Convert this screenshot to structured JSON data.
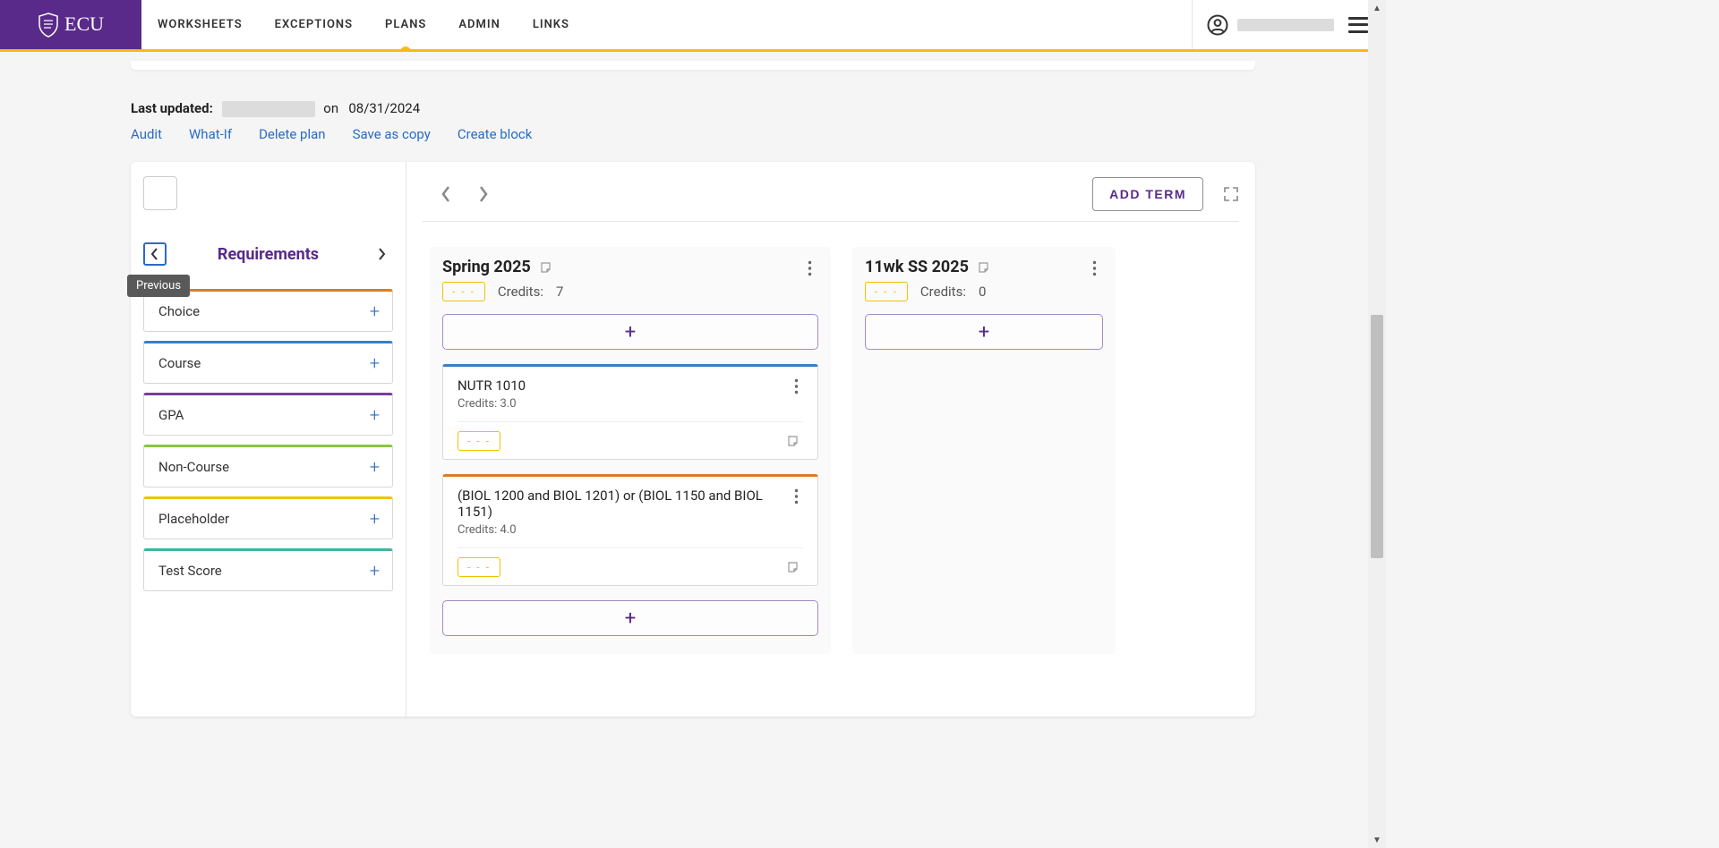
{
  "brand": {
    "name": "ECU"
  },
  "nav": {
    "items": [
      "WORKSHEETS",
      "EXCEPTIONS",
      "PLANS",
      "ADMIN",
      "LINKS"
    ],
    "activeIndex": 2
  },
  "meta": {
    "label": "Last updated:",
    "on": "on",
    "date": "08/31/2024"
  },
  "actions": {
    "audit": "Audit",
    "whatif": "What-If",
    "delete": "Delete plan",
    "saveas": "Save as copy",
    "createblock": "Create block"
  },
  "sidebar": {
    "title": "Requirements",
    "tooltip": "Previous",
    "items": [
      {
        "label": "Choice",
        "color": "#e07b1f"
      },
      {
        "label": "Course",
        "color": "#3b7ec1"
      },
      {
        "label": "GPA",
        "color": "#7a3b9d"
      },
      {
        "label": "Non-Course",
        "color": "#8bc53f"
      },
      {
        "label": "Placeholder",
        "color": "#f0c200"
      },
      {
        "label": "Test Score",
        "color": "#3fb59f"
      }
    ]
  },
  "toolbar": {
    "addTerm": "ADD TERM"
  },
  "terms": [
    {
      "title": "Spring 2025",
      "creditsLabel": "Credits:",
      "creditsValue": "7",
      "courses": [
        {
          "title": "NUTR 1010",
          "creditsLabel": "Credits:",
          "creditsValue": "3.0",
          "color": "#3b7ec1"
        },
        {
          "title": "(BIOL 1200 and BIOL 1201) or (BIOL 1150 and BIOL 1151)",
          "creditsLabel": "Credits:",
          "creditsValue": "4.0",
          "color": "#e07b1f"
        }
      ]
    },
    {
      "title": "11wk SS 2025",
      "creditsLabel": "Credits:",
      "creditsValue": "0",
      "courses": []
    }
  ],
  "creditsJoin": " "
}
